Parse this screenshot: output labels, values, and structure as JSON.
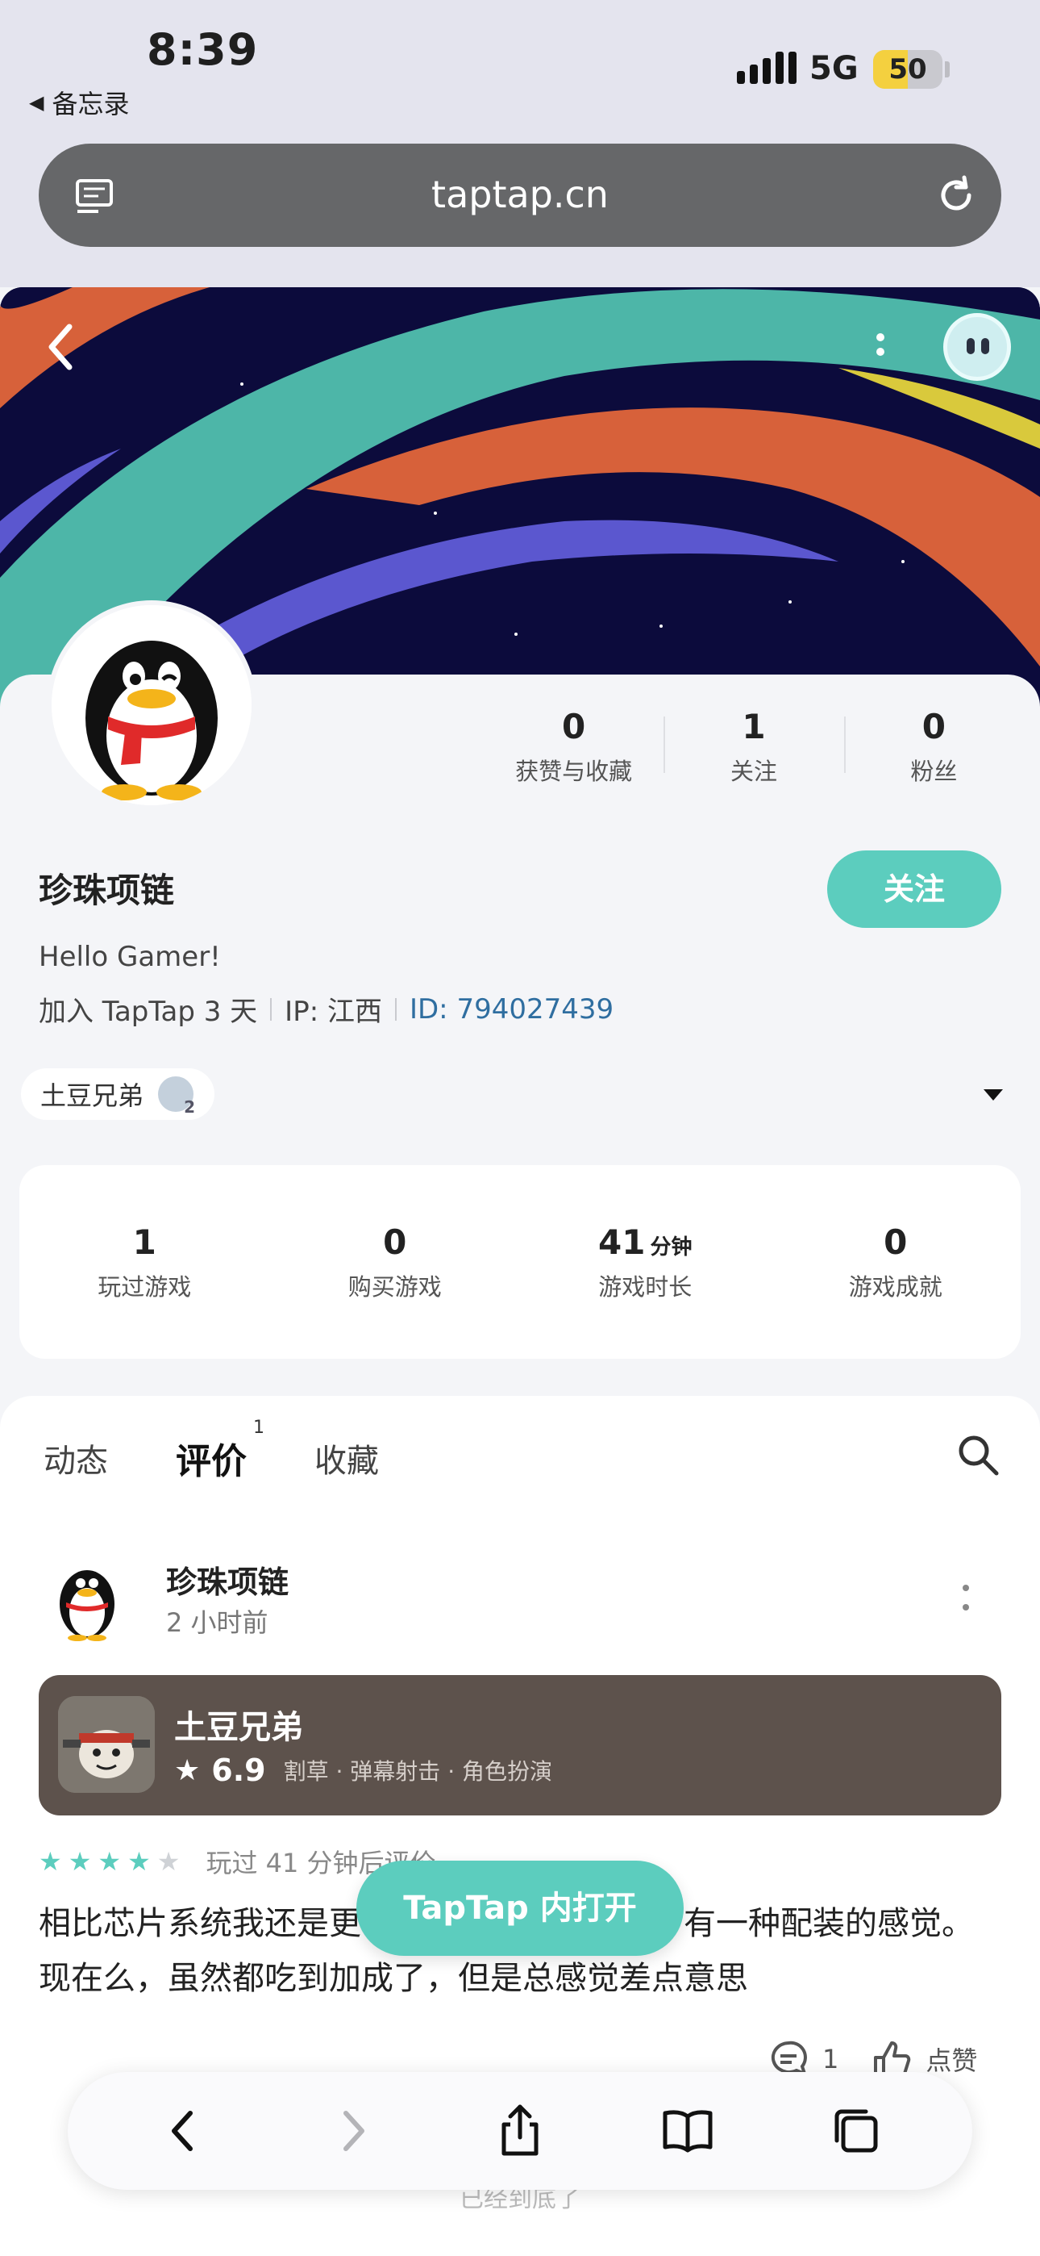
{
  "status_bar": {
    "time": "8:39",
    "back_app_label": "备忘录",
    "network": "5G",
    "battery": "50"
  },
  "url_bar": {
    "url": "taptap.cn"
  },
  "profile": {
    "stats": [
      {
        "num": "0",
        "label": "获赞与收藏"
      },
      {
        "num": "1",
        "label": "关注"
      },
      {
        "num": "0",
        "label": "粉丝"
      }
    ],
    "name": "珍珠项链",
    "follow_label": "关注",
    "bio": "Hello Gamer!",
    "joined": "加入 TapTap 3 天",
    "ip": "IP: 江西",
    "id": "ID: 794027439",
    "game_chip": "土豆兄弟",
    "game_stats": [
      {
        "num": "1",
        "unit": "",
        "label": "玩过游戏"
      },
      {
        "num": "0",
        "unit": "",
        "label": "购买游戏"
      },
      {
        "num": "41",
        "unit": "分钟",
        "label": "游戏时长"
      },
      {
        "num": "0",
        "unit": "",
        "label": "游戏成就"
      }
    ]
  },
  "tabs": {
    "items": [
      {
        "label": "动态"
      },
      {
        "label": "评价",
        "badge": "1"
      },
      {
        "label": "收藏"
      }
    ]
  },
  "review": {
    "user": "珍珠项链",
    "time": "2 小时前",
    "game": {
      "title": "土豆兄弟",
      "score": "6.9",
      "tags": "割草 · 弹幕射击 · 角色扮演"
    },
    "rating_stars": 4,
    "played": "玩过 41 分钟后评价",
    "text_line1": "相比芯片系统我还是更",
    "text_line1_end": "有一种配装的感觉。",
    "text_line2": "现在么，虽然都吃到加成了，但是总感觉差点意思",
    "comment_count": "1",
    "like_label": "点赞"
  },
  "open_in_app": "TapTap 内打开",
  "bottom_end": "已经到底了",
  "colors": {
    "accent": "#5ccdbe",
    "id_link": "#2f6ea0",
    "card_bg": "#5d524c"
  }
}
